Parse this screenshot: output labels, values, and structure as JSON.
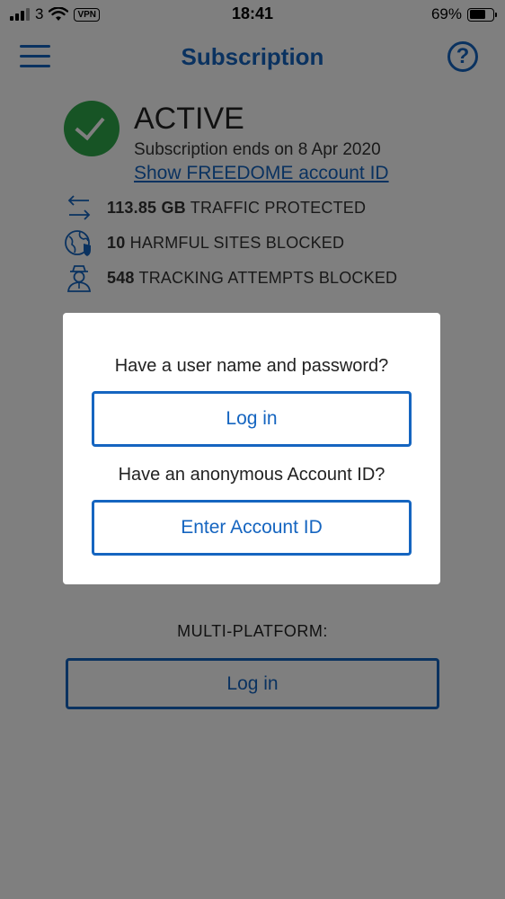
{
  "status_bar": {
    "carrier": "3",
    "vpn": "VPN",
    "time": "18:41",
    "battery": "69%",
    "battery_level": 0.69
  },
  "nav": {
    "title": "Subscription",
    "help_icon": "question-circle-icon",
    "menu_icon": "hamburger-menu-icon"
  },
  "subscription": {
    "status": "ACTIVE",
    "ends": "Subscription ends on 8 Apr 2020",
    "show_id_link": "Show FREEDOME account ID"
  },
  "stats": [
    {
      "icon": "traffic-arrows-icon",
      "value": "113.85 GB",
      "label": "TRAFFIC PROTECTED"
    },
    {
      "icon": "globe-shield-icon",
      "value": "10",
      "label": "HARMFUL SITES BLOCKED"
    },
    {
      "icon": "spy-tracker-icon",
      "value": "548",
      "label": "TRACKING ATTEMPTS BLOCKED"
    }
  ],
  "multi_platform": {
    "label": "MULTI-PLATFORM:",
    "login_label": "Log in"
  },
  "dialog": {
    "q1": "Have a user name and password?",
    "login_label": "Log in",
    "q2": "Have an anonymous Account ID?",
    "enter_id_label": "Enter Account ID"
  },
  "colors": {
    "accent": "#1565c0",
    "active_green": "#2ea84a"
  }
}
